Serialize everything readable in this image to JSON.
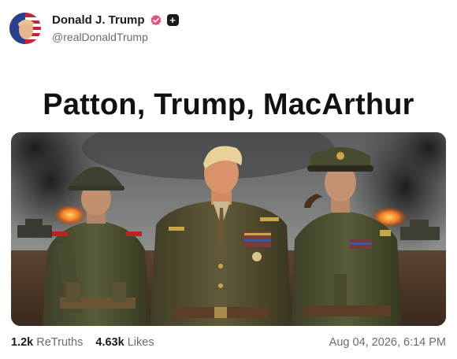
{
  "post": {
    "author": {
      "display_name": "Donald J. Trump",
      "handle": "@realDonaldTrump",
      "verified_icon": "verified-badge-icon",
      "plus_icon": "plus-badge-icon",
      "plus_symbol": "+"
    },
    "headline": "Patton, Trump, MacArthur",
    "image": {
      "description_icon": "ai-image-three-generals"
    },
    "stats": {
      "retruths_count": "1.2k",
      "retruths_label": "ReTruths",
      "likes_count": "4.63k",
      "likes_label": "Likes"
    },
    "timestamp": "Aug 04, 2026, 6:14 PM"
  },
  "colors": {
    "verified": "#e8527a",
    "text_primary": "#1b1b1b",
    "text_secondary": "#6b6b6b"
  }
}
